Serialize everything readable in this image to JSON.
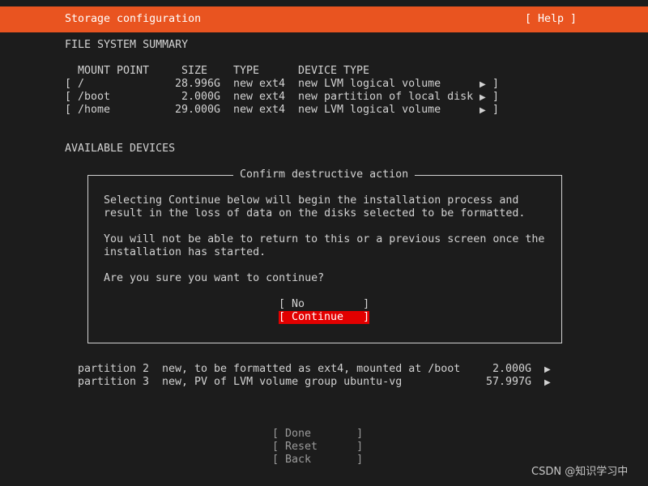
{
  "header": {
    "title": "Storage configuration",
    "help_label": "[ Help ]"
  },
  "fs_summary": {
    "heading": "FILE SYSTEM SUMMARY",
    "columns": [
      "MOUNT POINT",
      "SIZE",
      "TYPE",
      "DEVICE TYPE"
    ],
    "rows": [
      {
        "mount": "/",
        "size": "28.996G",
        "type": "new ext4",
        "device_type": "new LVM logical volume"
      },
      {
        "mount": "/boot",
        "size": "2.000G",
        "type": "new ext4",
        "device_type": "new partition of local disk"
      },
      {
        "mount": "/home",
        "size": "29.000G",
        "type": "new ext4",
        "device_type": "new LVM logical volume"
      }
    ]
  },
  "available_devices": {
    "heading": "AVAILABLE DEVICES",
    "rows": [
      {
        "name": "partition 2",
        "desc": "new, to be formatted as ext4, mounted at /boot",
        "size": "2.000G"
      },
      {
        "name": "partition 3",
        "desc": "new, PV of LVM volume group ubuntu-vg",
        "size": "57.997G"
      }
    ]
  },
  "dialog": {
    "title": "Confirm destructive action",
    "para1": [
      "Selecting Continue below will begin the installation process and",
      "result in the loss of data on the disks selected to be formatted."
    ],
    "para2": [
      "You will not be able to return to this or a previous screen once the",
      "installation has started."
    ],
    "question": "Are you sure you want to continue?",
    "no_label": "[ No         ]",
    "continue_label": "[ Continue   ]"
  },
  "footer": {
    "done_label": "[ Done       ]",
    "reset_label": "[ Reset      ]",
    "back_label": "[ Back       ]"
  },
  "watermark": "CSDN @知识学习中",
  "icons": {
    "row_arrow": "triangle-right-icon"
  },
  "colors": {
    "header_bg": "#e95420",
    "selected_bg": "#e20000",
    "bg": "#1c1c1c"
  }
}
